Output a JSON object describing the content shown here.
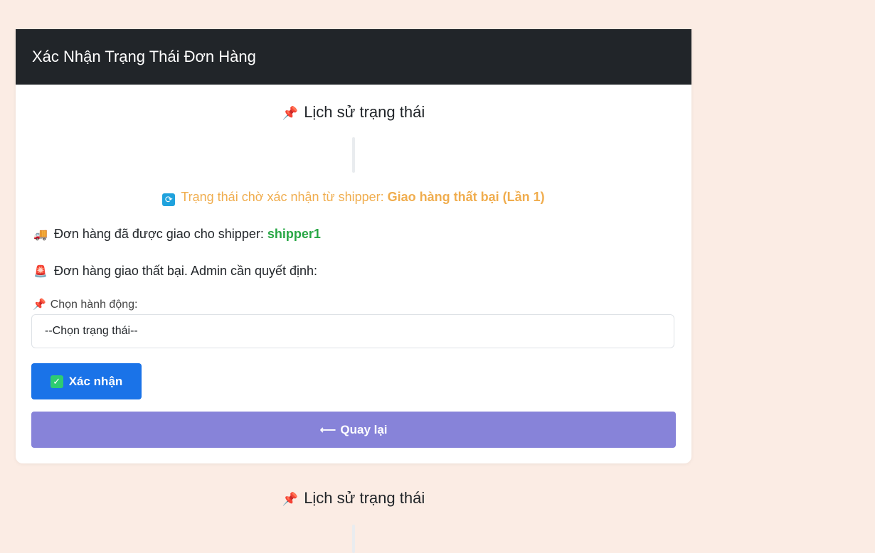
{
  "header": {
    "title": "Xác Nhận Trạng Thái Đơn Hàng"
  },
  "history": {
    "title": "Lịch sử trạng thái",
    "icon": "pushpin-icon"
  },
  "pending": {
    "prefix": "Trạng thái chờ xác nhận từ shipper: ",
    "status": "Giao hàng thất bại (Lần 1)",
    "color": "#f0ad4e"
  },
  "assigned": {
    "text": "Đơn hàng đã được giao cho shipper: ",
    "shipper": "shipper1",
    "icon": "delivery-truck-icon"
  },
  "failed": {
    "text": "Đơn hàng giao thất bại. Admin cần quyết định:",
    "icon": "siren-icon"
  },
  "action": {
    "label": "Chọn hành động:",
    "selected": "--Chọn trạng thái--"
  },
  "buttons": {
    "confirm": "Xác nhận",
    "back": "Quay lại",
    "confirm_color": "#1a73e8",
    "back_color": "#8783d9"
  },
  "outer_history": {
    "title": "Lịch sử trạng thái"
  }
}
